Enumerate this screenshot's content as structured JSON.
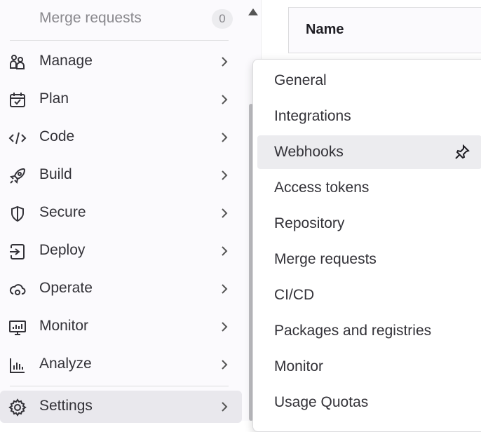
{
  "sidebar": {
    "pinned_item": {
      "label": "Merge requests",
      "count": "0"
    },
    "items": [
      {
        "label": "Manage",
        "icon": "users-icon"
      },
      {
        "label": "Plan",
        "icon": "calendar-icon"
      },
      {
        "label": "Code",
        "icon": "code-icon"
      },
      {
        "label": "Build",
        "icon": "rocket-icon"
      },
      {
        "label": "Secure",
        "icon": "shield-icon"
      },
      {
        "label": "Deploy",
        "icon": "deploy-icon"
      },
      {
        "label": "Operate",
        "icon": "cloud-gear-icon"
      },
      {
        "label": "Monitor",
        "icon": "monitor-icon"
      },
      {
        "label": "Analyze",
        "icon": "chart-icon"
      },
      {
        "label": "Settings",
        "icon": "gear-icon"
      }
    ]
  },
  "table": {
    "header": "Name"
  },
  "flyout": {
    "items": [
      {
        "label": "General"
      },
      {
        "label": "Integrations"
      },
      {
        "label": "Webhooks"
      },
      {
        "label": "Access tokens"
      },
      {
        "label": "Repository"
      },
      {
        "label": "Merge requests"
      },
      {
        "label": "CI/CD"
      },
      {
        "label": "Packages and registries"
      },
      {
        "label": "Monitor"
      },
      {
        "label": "Usage Quotas"
      }
    ]
  },
  "colors": {
    "active_bg": "#e9e8ed",
    "hover_bg": "#ececef",
    "text": "#333238",
    "muted": "#89888d"
  }
}
